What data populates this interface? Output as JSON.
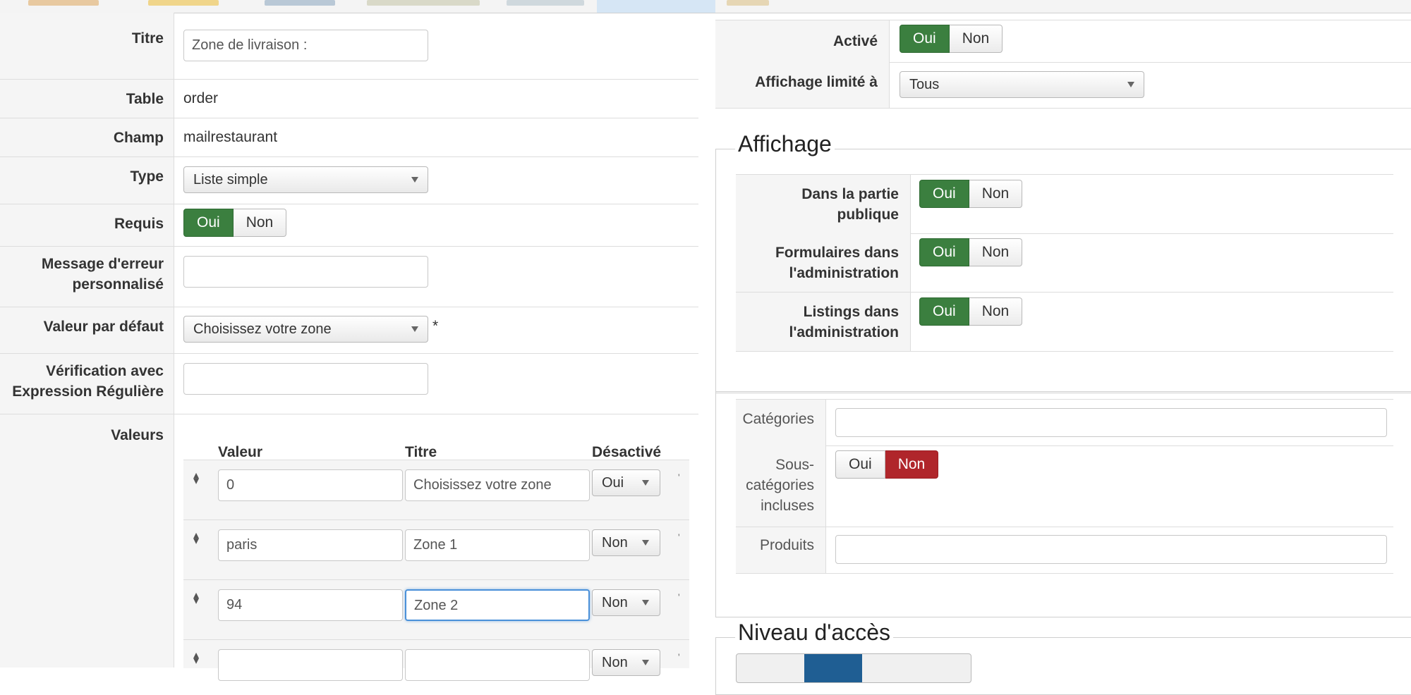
{
  "form": {
    "titre": {
      "label": "Titre",
      "value": "Zone de livraison :"
    },
    "table": {
      "label": "Table",
      "value": "order"
    },
    "champ": {
      "label": "Champ",
      "value": "mailrestaurant"
    },
    "type": {
      "label": "Type",
      "value": "Liste simple"
    },
    "requis": {
      "label": "Requis",
      "yes": "Oui",
      "no": "Non",
      "selected": "Oui"
    },
    "message": {
      "label_line1": "Message d'erreur",
      "label_line2": "personnalisé",
      "value": ""
    },
    "defaut": {
      "label": "Valeur par défaut",
      "value": "Choisissez votre zone",
      "asterisk": "*"
    },
    "regex": {
      "label_line1": "Vérification avec",
      "label_line2": "Expression Régulière",
      "value": ""
    },
    "valeurs": {
      "label": "Valeurs",
      "headers": {
        "valeur": "Valeur",
        "titre": "Titre",
        "desactive": "Désactivé"
      },
      "rows": [
        {
          "valeur": "0",
          "titre": "Choisissez votre zone",
          "desactive": "Oui"
        },
        {
          "valeur": "paris",
          "titre": "Zone 1",
          "desactive": "Non"
        },
        {
          "valeur": "94",
          "titre": "Zone 2",
          "desactive": "Non"
        },
        {
          "valeur": "",
          "titre": "",
          "desactive": "Non"
        }
      ]
    }
  },
  "publish": {
    "active": {
      "label": "Activé",
      "yes": "Oui",
      "no": "Non",
      "selected": "Oui"
    },
    "limited": {
      "label": "Affichage limité à",
      "value": "Tous"
    }
  },
  "affichage": {
    "legend": "Affichage",
    "public": {
      "label_line1": "Dans la partie",
      "label_line2": "publique",
      "yes": "Oui",
      "no": "Non",
      "selected": "Oui"
    },
    "forms": {
      "label_line1": "Formulaires dans",
      "label_line2": "l'administration",
      "yes": "Oui",
      "no": "Non",
      "selected": "Oui"
    },
    "listings": {
      "label_line1": "Listings dans",
      "label_line2": "l'administration",
      "yes": "Oui",
      "no": "Non",
      "selected": "Oui"
    }
  },
  "categories": {
    "cat_label": "Catégories",
    "cat_value": "",
    "sub_label_line1": "Sous-",
    "sub_label_line2": "catégories",
    "sub_label_line3": "incluses",
    "sub_yes": "Oui",
    "sub_no": "Non",
    "sub_selected": "Non",
    "products_label": "Produits",
    "products_value": ""
  },
  "access": {
    "legend": "Niveau d'accès"
  },
  "colors": {
    "green": "#3b7f3f",
    "red": "#b0262b",
    "label_bg": "#f5f5f5"
  }
}
